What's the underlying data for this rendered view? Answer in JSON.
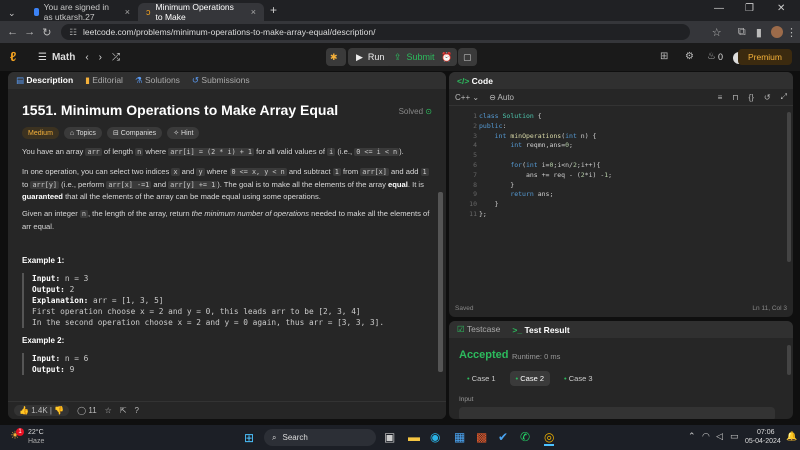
{
  "browser": {
    "tabs": [
      {
        "title": "You are signed in as utkarsh.27"
      },
      {
        "title": "Minimum Operations to Make"
      }
    ],
    "url": "leetcode.com/problems/minimum-operations-to-make-array-equal/description/"
  },
  "nav": {
    "list_label": "Math",
    "run_label": "Run",
    "submit_label": "Submit",
    "streak": "0",
    "premium_label": "Premium"
  },
  "problem": {
    "tabs": [
      "Description",
      "Editorial",
      "Solutions",
      "Submissions"
    ],
    "title": "1551. Minimum Operations to Make Array Equal",
    "status": "Solved",
    "difficulty": "Medium",
    "tags": [
      "Topics",
      "Companies",
      "Hint"
    ],
    "p1_a": "You have an array",
    "p1_c1": "arr",
    "p1_b": "of length",
    "p1_c2": "n",
    "p1_c": "where",
    "p1_c3": "arr[i] = (2 * i) + 1",
    "p1_d": "for all valid values of",
    "p1_c4": "i",
    "p1_e": "(i.e.,",
    "p1_c5": "0 <= i < n",
    "p1_f": ").",
    "p2_a": "In one operation, you can select two indices",
    "p2_c1": "x",
    "p2_b": "and",
    "p2_c2": "y",
    "p2_c": "where",
    "p2_c3": "0 <= x, y < n",
    "p2_d": "and subtract",
    "p2_c4": "1",
    "p2_e": "from",
    "p2_c5": "arr[x]",
    "p2_f": "and add",
    "p2_c6": "1",
    "p2_g": "to",
    "p2_c7": "arr[y]",
    "p2_h": "(i.e., perform",
    "p2_c8": "arr[x] -=1",
    "p2_i": "and",
    "p2_c9": "arr[y] += 1",
    "p2_j": "). The goal is to make all the elements of the array",
    "p2_bold1": "equal",
    "p2_k": ". It is",
    "p2_bold2": "guaranteed",
    "p2_l": "that all the elements of the array can be made equal using some operations.",
    "p3_a": "Given an integer",
    "p3_c1": "n",
    "p3_b": ", the length of the array, return",
    "p3_em": "the minimum number of operations",
    "p3_c": "needed to make all the elements of arr equal.",
    "ex1_title": "Example 1:",
    "ex1_input_label": "Input:",
    "ex1_input": "n = 3",
    "ex1_output_label": "Output:",
    "ex1_output": "2",
    "ex1_expl_label": "Explanation:",
    "ex1_expl": "arr = [1, 3, 5]",
    "ex1_l1": "First operation choose x = 2 and y = 0, this leads arr to be [2, 3, 4]",
    "ex1_l2": "In the second operation choose x = 2 and y = 0 again, thus arr = [3, 3, 3].",
    "ex2_title": "Example 2:",
    "ex2_input_label": "Input:",
    "ex2_input": "n = 6",
    "ex2_output_label": "Output:",
    "ex2_output": "9",
    "likes": "1.4K",
    "comments": "11"
  },
  "editor": {
    "title": "Code",
    "language": "C++",
    "autocomplete": "Auto",
    "line_numbers": [
      "1",
      "2",
      "3",
      "4",
      "5",
      "6",
      "7",
      "8",
      "9",
      "10",
      "11"
    ],
    "saved_label": "Saved",
    "cursor": "Ln 11, Col 3"
  },
  "results": {
    "tab_testcase": "Testcase",
    "tab_result": "Test Result",
    "status": "Accepted",
    "runtime": "Runtime: 0 ms",
    "cases": [
      "Case 1",
      "Case 2",
      "Case 3"
    ],
    "input_label": "Input"
  },
  "taskbar": {
    "temp": "22°C",
    "weather": "Haze",
    "search": "Search",
    "time": "07:06",
    "date": "05-04-2024",
    "notif": "1"
  }
}
